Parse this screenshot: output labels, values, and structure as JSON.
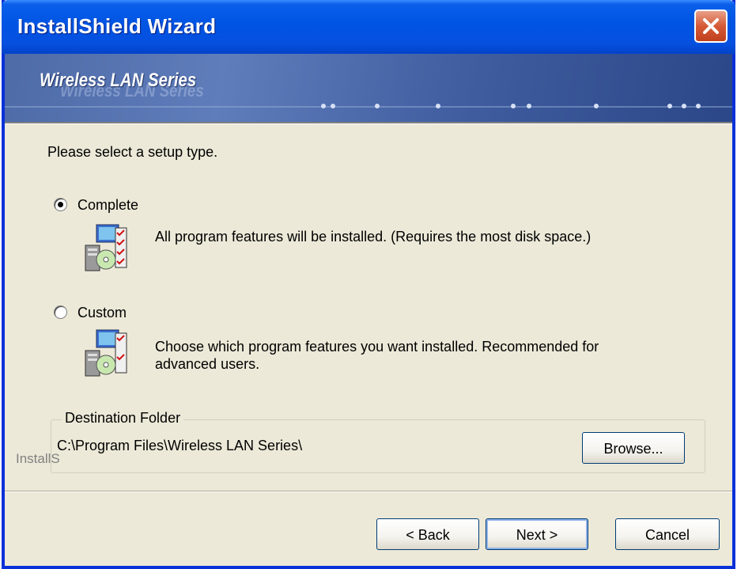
{
  "window": {
    "title": "InstallShield Wizard",
    "close_icon": "close-icon"
  },
  "banner": {
    "title": "Wireless LAN Series"
  },
  "content": {
    "prompt": "Please select a setup type.",
    "options": [
      {
        "label": "Complete",
        "selected": true,
        "description": "All program features will be installed. (Requires the most disk space.)",
        "icon": "setup-complete-icon"
      },
      {
        "label": "Custom",
        "selected": false,
        "description": "Choose which program features you want installed. Recommended for advanced users.",
        "icon": "setup-custom-icon"
      }
    ],
    "destination": {
      "legend": "Destination Folder",
      "path": "C:\\Program Files\\Wireless LAN Series\\",
      "browse_label": "Browse..."
    },
    "watermark": "InstallS"
  },
  "footer": {
    "back_label": "< Back",
    "next_label": "Next >",
    "cancel_label": "Cancel"
  },
  "colors": {
    "title_bar": "#0054E3",
    "dialog_bg": "#ECE9D8",
    "close_button": "#D55A36"
  }
}
